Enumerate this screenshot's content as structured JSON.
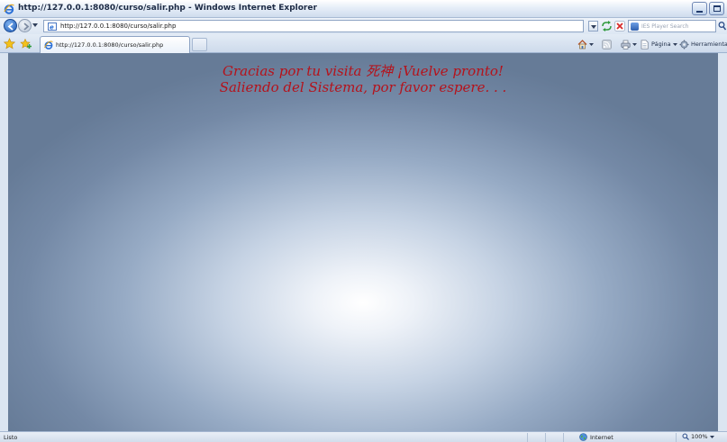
{
  "window": {
    "title": "http://127.0.0.1:8080/curso/salir.php - Windows Internet Explorer"
  },
  "address_bar": {
    "url": "http://127.0.0.1:8080/curso/salir.php"
  },
  "search": {
    "placeholder": "IES Player Search"
  },
  "tabs": [
    {
      "label": "http://127.0.0.1:8080/curso/salir.php"
    }
  ],
  "command_bar": {
    "page_label": "Página",
    "tools_label": "Herramientas"
  },
  "page": {
    "line1": "Gracias por tu visita 死神 ¡Vuelve pronto!",
    "line2": "Saliendo del Sistema, por favor espere. . .",
    "text_color": "#b5121b"
  },
  "status_bar": {
    "text": "Listo",
    "zone": "Internet",
    "zoom": "100%"
  }
}
